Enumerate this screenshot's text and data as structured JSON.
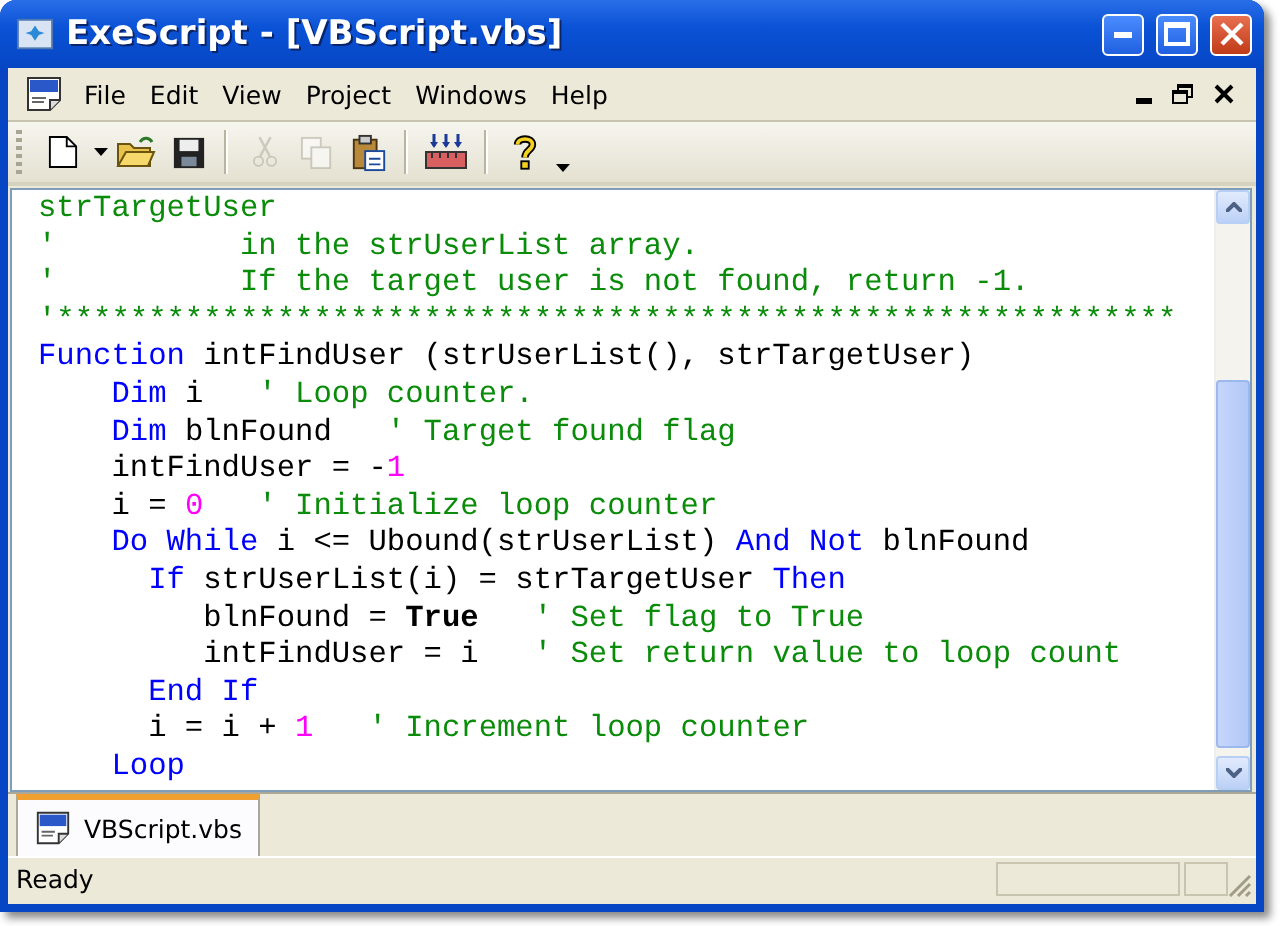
{
  "window": {
    "title": "ExeScript - [VBScript.vbs]"
  },
  "menu": [
    "File",
    "Edit",
    "View",
    "Project",
    "Windows",
    "Help"
  ],
  "toolbar": [
    [
      {
        "kind": "new",
        "disabled": false,
        "dropdown": true
      },
      {
        "kind": "open",
        "disabled": false,
        "dropdown": false
      },
      {
        "kind": "save",
        "disabled": false,
        "dropdown": false
      }
    ],
    [
      {
        "kind": "cut",
        "disabled": true,
        "dropdown": false
      },
      {
        "kind": "copy",
        "disabled": true,
        "dropdown": false
      },
      {
        "kind": "paste",
        "disabled": false,
        "dropdown": false
      }
    ],
    [
      {
        "kind": "build",
        "disabled": false,
        "dropdown": false
      }
    ],
    [
      {
        "kind": "help",
        "disabled": false,
        "dropdown": true
      }
    ]
  ],
  "editor": {
    "lines": [
      [
        {
          "kind": "comment",
          "text": "strTargetUser"
        }
      ],
      [
        {
          "kind": "comment",
          "text": "'          in the strUserList array."
        }
      ],
      [
        {
          "kind": "comment",
          "text": "'          If the target user is not found, return -1."
        }
      ],
      [
        {
          "kind": "comment",
          "text": "'*************************************************************"
        }
      ],
      [
        {
          "kind": "keyword",
          "text": "Function"
        },
        {
          "kind": "plain",
          "text": " intFindUser (strUserList(), strTargetUser)"
        }
      ],
      [
        {
          "kind": "keyword",
          "text": "    Dim"
        },
        {
          "kind": "plain",
          "text": " i   "
        },
        {
          "kind": "comment",
          "text": "' Loop counter."
        }
      ],
      [
        {
          "kind": "keyword",
          "text": "    Dim"
        },
        {
          "kind": "plain",
          "text": " blnFound   "
        },
        {
          "kind": "comment",
          "text": "' Target found flag"
        }
      ],
      [
        {
          "kind": "plain",
          "text": "    intFindUser = -"
        },
        {
          "kind": "number",
          "text": "1"
        }
      ],
      [
        {
          "kind": "plain",
          "text": "    i = "
        },
        {
          "kind": "number",
          "text": "0"
        },
        {
          "kind": "comment",
          "text": "   ' Initialize loop counter"
        }
      ],
      [
        {
          "kind": "keyword",
          "text": "    Do While"
        },
        {
          "kind": "plain",
          "text": " i <= Ubound(strUserList) "
        },
        {
          "kind": "keyword",
          "text": "And Not"
        },
        {
          "kind": "plain",
          "text": " blnFound"
        }
      ],
      [
        {
          "kind": "keyword",
          "text": "      If"
        },
        {
          "kind": "plain",
          "text": " strUserList(i) = strTargetUser "
        },
        {
          "kind": "keyword",
          "text": "Then"
        }
      ],
      [
        {
          "kind": "plain",
          "text": "         blnFound = "
        },
        {
          "kind": "bold",
          "text": "True"
        },
        {
          "kind": "comment",
          "text": "   ' Set flag to True"
        }
      ],
      [
        {
          "kind": "plain",
          "text": "         intFindUser = i   "
        },
        {
          "kind": "comment",
          "text": "' Set return value to loop count"
        }
      ],
      [
        {
          "kind": "keyword",
          "text": "      End If"
        }
      ],
      [
        {
          "kind": "plain",
          "text": "      i = i + "
        },
        {
          "kind": "number",
          "text": "1"
        },
        {
          "kind": "comment",
          "text": "   ' Increment loop counter"
        }
      ],
      [
        {
          "kind": "keyword",
          "text": "    Loop"
        }
      ]
    ]
  },
  "tabs": [
    {
      "label": "VBScript.vbs",
      "selected": true
    }
  ],
  "status_bar": {
    "text": "Ready"
  }
}
